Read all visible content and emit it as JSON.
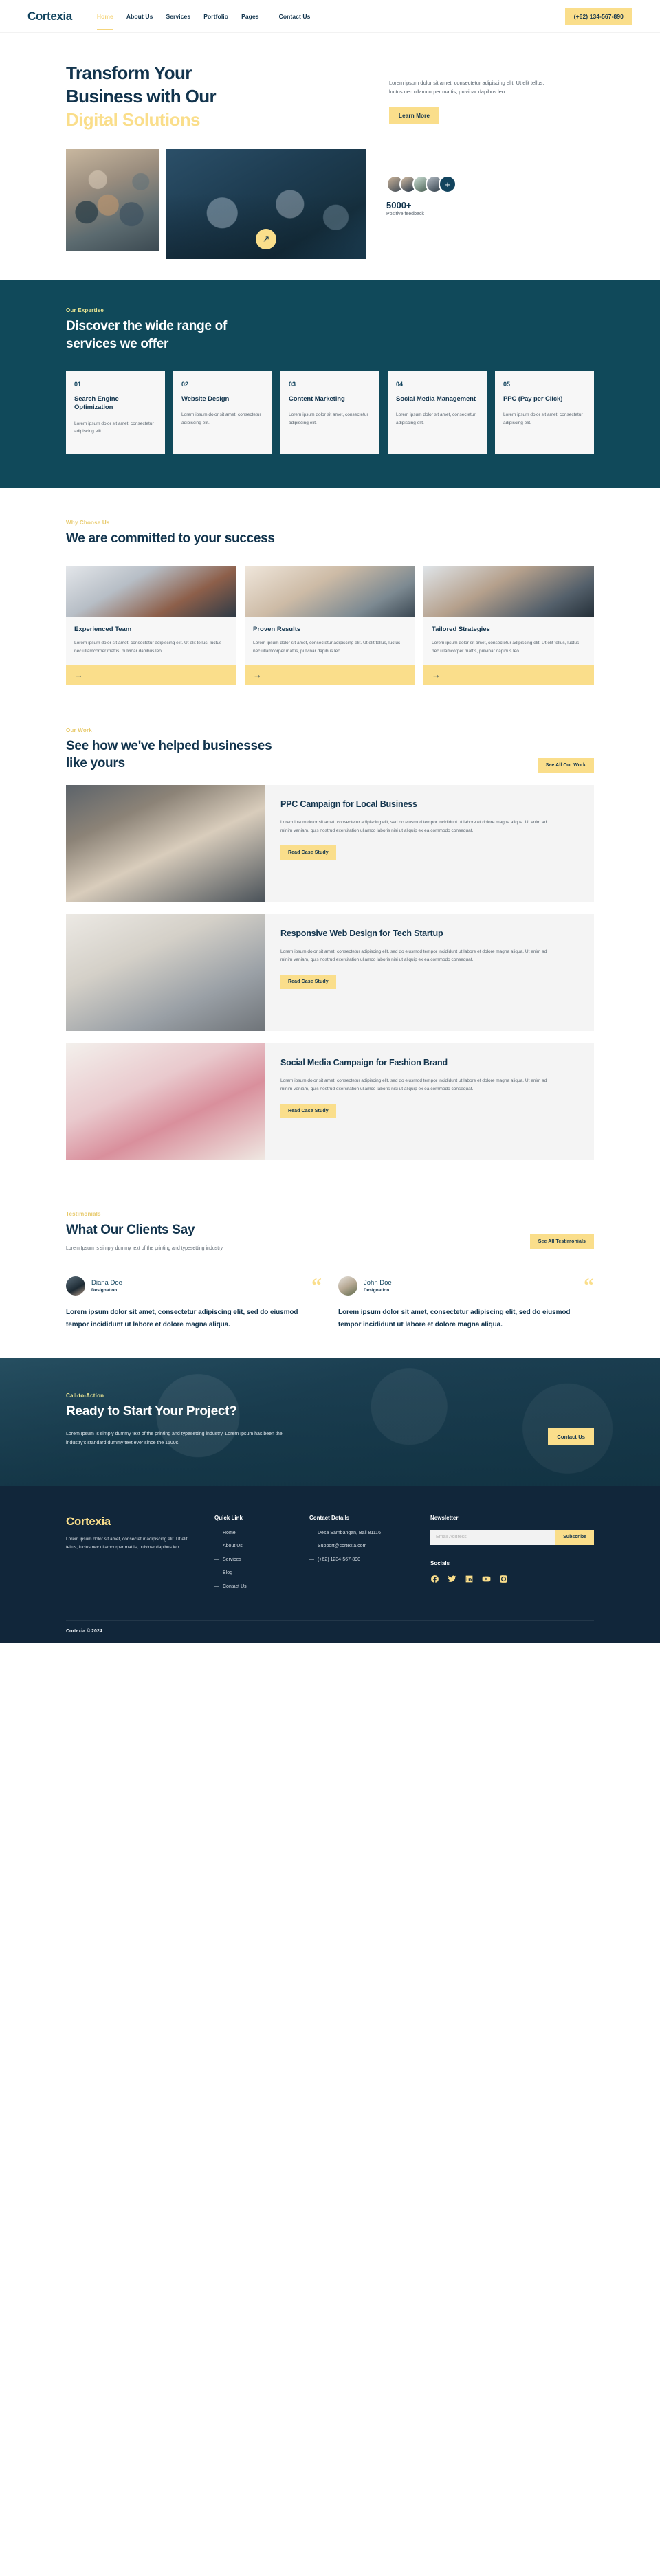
{
  "header": {
    "brand": "Cortexia",
    "nav": [
      {
        "label": "Home",
        "active": true
      },
      {
        "label": "About Us",
        "active": false
      },
      {
        "label": "Services",
        "active": false
      },
      {
        "label": "Portfolio",
        "active": false
      },
      {
        "label": "Pages",
        "active": false,
        "has_plus": true
      },
      {
        "label": "Contact Us",
        "active": false
      }
    ],
    "phone_button": "(+62) 134-567-890"
  },
  "hero": {
    "title_line1": "Transform Your",
    "title_line2": "Business with Our",
    "title_line3": "Digital Solutions",
    "description": "Lorem ipsum dolor sit amet, consectetur adipiscing elit. Ut elit tellus, luctus nec ullamcorper mattis, pulvinar dapibus leo.",
    "cta_label": "Learn More",
    "arrow_icon": "arrow-up-right-icon",
    "stat_number": "5000+",
    "stat_label": "Positive feedback",
    "avatar_more": "+"
  },
  "services": {
    "eyebrow": "Our Expertise",
    "title": "Discover the wide range of services we offer",
    "cards": [
      {
        "num": "01",
        "name": "Search Engine Optimization",
        "desc": "Lorem ipsum dolor sit amet, consectetur adipiscing elit."
      },
      {
        "num": "02",
        "name": "Website Design",
        "desc": "Lorem ipsum dolor sit amet, consectetur adipiscing elit."
      },
      {
        "num": "03",
        "name": "Content Marketing",
        "desc": "Lorem ipsum dolor sit amet, consectetur adipiscing elit."
      },
      {
        "num": "04",
        "name": "Social Media Management",
        "desc": "Lorem ipsum dolor sit amet, consectetur adipiscing elit."
      },
      {
        "num": "05",
        "name": "PPC (Pay per Click)",
        "desc": "Lorem ipsum dolor sit amet, consectetur adipiscing elit."
      }
    ]
  },
  "why": {
    "eyebrow": "Why Choose Us",
    "title": "We are committed to your success",
    "cards": [
      {
        "name": "Experienced Team",
        "desc": "Lorem ipsum dolor sit amet, consectetur adipiscing elit. Ut elit tellus, luctus nec ullamcorper mattis, pulvinar dapibus leo.",
        "arrow": "→"
      },
      {
        "name": "Proven Results",
        "desc": "Lorem ipsum dolor sit amet, consectetur adipiscing elit. Ut elit tellus, luctus nec ullamcorper mattis, pulvinar dapibus leo.",
        "arrow": "→"
      },
      {
        "name": "Tailored Strategies",
        "desc": "Lorem ipsum dolor sit amet, consectetur adipiscing elit. Ut elit tellus, luctus nec ullamcorper mattis, pulvinar dapibus leo.",
        "arrow": "→"
      }
    ]
  },
  "work": {
    "eyebrow": "Our Work",
    "title": "See how we've helped businesses like yours",
    "see_all_label": "See All Our Work",
    "cases": [
      {
        "title": "PPC Campaign for Local Business",
        "desc": "Lorem ipsum dolor sit amet, consectetur adipiscing elit, sed do eiusmod tempor incididunt ut labore et dolore magna aliqua. Ut enim ad minim veniam, quis nostrud exercitation ullamco laboris nisi ut aliquip ex ea commodo consequat.",
        "btn": "Read Case Study"
      },
      {
        "title": "Responsive Web Design for Tech Startup",
        "desc": "Lorem ipsum dolor sit amet, consectetur adipiscing elit, sed do eiusmod tempor incididunt ut labore et dolore magna aliqua. Ut enim ad minim veniam, quis nostrud exercitation ullamco laboris nisi ut aliquip ex ea commodo consequat.",
        "btn": "Read Case Study"
      },
      {
        "title": "Social Media Campaign for Fashion Brand",
        "desc": "Lorem ipsum dolor sit amet, consectetur adipiscing elit, sed do eiusmod tempor incididunt ut labore et dolore magna aliqua. Ut enim ad minim veniam, quis nostrud exercitation ullamco laboris nisi ut aliquip ex ea commodo consequat.",
        "btn": "Read Case Study"
      }
    ]
  },
  "testimonials": {
    "eyebrow": "Testimonials",
    "title": "What Our Clients Say",
    "subtitle": "Lorem Ipsum is simply dummy text of the printing and typesetting industry.",
    "see_all_label": "See All Testimonials",
    "quote_mark": "“",
    "items": [
      {
        "name": "Diana Doe",
        "role": "Designation",
        "text": "Lorem ipsum dolor sit amet, consectetur adipiscing elit, sed do eiusmod tempor incididunt ut labore et dolore magna aliqua."
      },
      {
        "name": "John Doe",
        "role": "Designation",
        "text": "Lorem ipsum dolor sit amet, consectetur adipiscing elit, sed do eiusmod tempor incididunt ut labore et dolore magna aliqua."
      }
    ]
  },
  "cta": {
    "eyebrow": "Call-to-Action",
    "title": "Ready to Start Your Project?",
    "description": "Lorem Ipsum is simply dummy text of the printing and typesetting industry. Lorem Ipsum has been the industry's standard dummy text ever since the 1500s.",
    "button": "Contact Us"
  },
  "footer": {
    "logo": "Cortexia",
    "about": "Lorem ipsum dolor sit amet, consectetur adipiscing elit. Ut elit tellus, luctus nec ullamcorper mattis, pulvinar dapibus leo.",
    "quick_link_heading": "Quick Link",
    "quick_links": [
      "Home",
      "About Us",
      "Services",
      "Blog",
      "Contact Us"
    ],
    "contact_heading": "Contact Details",
    "contact_items": [
      "Desa Sambangan, Bali 81116",
      "Support@cortexia.com",
      "(+62) 1234-567-890"
    ],
    "newsletter_heading": "Newsletter",
    "newsletter_placeholder": "Email Address",
    "newsletter_value": "",
    "subscribe_label": "Subscribe",
    "socials_heading": "Socials",
    "socials": [
      "facebook-icon",
      "twitter-icon",
      "linkedin-icon",
      "youtube-icon",
      "instagram-icon"
    ],
    "copyright": "Cortexia © 2024"
  },
  "colors": {
    "accent_yellow": "#fade8b",
    "brand_dark": "#12344d",
    "teal_dark": "#10495a",
    "footer_dark": "#11263a"
  }
}
